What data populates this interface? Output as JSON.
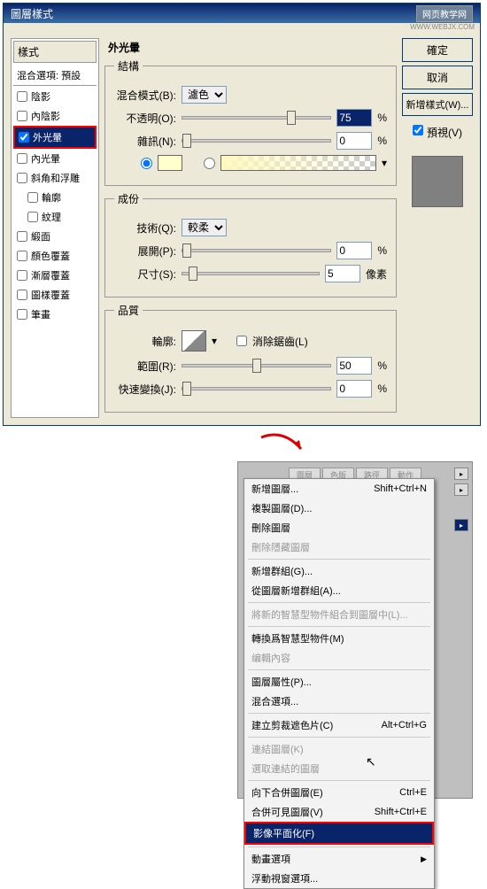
{
  "dialog": {
    "title": "圖層樣式",
    "badge": "网页教学网",
    "badge_sub": "WWW.WEBJX.COM"
  },
  "side": {
    "header": "樣式",
    "blend_line": "混合選項: 預設",
    "items": [
      {
        "label": "陰影",
        "checked": false,
        "selected": false
      },
      {
        "label": "內陰影",
        "checked": false,
        "selected": false
      },
      {
        "label": "外光暈",
        "checked": true,
        "selected": true
      },
      {
        "label": "內光暈",
        "checked": false,
        "selected": false
      },
      {
        "label": "斜角和浮雕",
        "checked": false,
        "selected": false
      },
      {
        "label": "輪廓",
        "checked": false,
        "selected": false,
        "indent": true
      },
      {
        "label": "紋理",
        "checked": false,
        "selected": false,
        "indent": true
      },
      {
        "label": "緞面",
        "checked": false,
        "selected": false
      },
      {
        "label": "顏色覆蓋",
        "checked": false,
        "selected": false
      },
      {
        "label": "漸層覆蓋",
        "checked": false,
        "selected": false
      },
      {
        "label": "圖樣覆蓋",
        "checked": false,
        "selected": false
      },
      {
        "label": "筆畫",
        "checked": false,
        "selected": false
      }
    ]
  },
  "outer_glow": {
    "title": "外光暈",
    "structure": {
      "legend": "結構",
      "blend_mode_label": "混合模式(B):",
      "blend_mode_value": "濾色",
      "opacity_label": "不透明(O):",
      "opacity_value": "75",
      "opacity_unit": "%",
      "noise_label": "雜訊(N):",
      "noise_value": "0",
      "noise_unit": "%"
    },
    "elements": {
      "legend": "成份",
      "technique_label": "技術(Q):",
      "technique_value": "較柔",
      "spread_label": "展開(P):",
      "spread_value": "0",
      "spread_unit": "%",
      "size_label": "尺寸(S):",
      "size_value": "5",
      "size_unit": "像素"
    },
    "quality": {
      "legend": "品質",
      "contour_label": "輪廓:",
      "antialias_label": "消除鋸齒(L)",
      "range_label": "範圍(R):",
      "range_value": "50",
      "range_unit": "%",
      "jitter_label": "快速變換(J):",
      "jitter_value": "0",
      "jitter_unit": "%"
    }
  },
  "buttons": {
    "ok": "確定",
    "cancel": "取消",
    "new_style": "新增樣式(W)...",
    "preview": "預視(V)"
  },
  "menu": {
    "tabs": [
      "圖層",
      "色版",
      "路徑",
      "動作"
    ],
    "items": [
      {
        "label": "新增圖層...",
        "shortcut": "Shift+Ctrl+N"
      },
      {
        "label": "複製圖層(D)..."
      },
      {
        "label": "刪除圖層"
      },
      {
        "label": "刪除隱藏圖層",
        "disabled": true
      },
      {
        "sep": true
      },
      {
        "label": "新增群組(G)..."
      },
      {
        "label": "從圖層新增群組(A)..."
      },
      {
        "sep": true
      },
      {
        "label": "將新的智慧型物件組合到圖層中(L)...",
        "disabled": true
      },
      {
        "sep": true
      },
      {
        "label": "轉換爲智慧型物件(M)"
      },
      {
        "label": "编輯內容",
        "disabled": true
      },
      {
        "sep": true
      },
      {
        "label": "圖層屬性(P)..."
      },
      {
        "label": "混合選項..."
      },
      {
        "sep": true
      },
      {
        "label": "建立剪裁遮色片(C)",
        "shortcut": "Alt+Ctrl+G"
      },
      {
        "sep": true
      },
      {
        "label": "連結圖層(K)",
        "disabled": true
      },
      {
        "label": "選取連結的圖層",
        "disabled": true
      },
      {
        "sep": true
      },
      {
        "label": "向下合併圖層(E)",
        "shortcut": "Ctrl+E"
      },
      {
        "label": "合併可見圖層(V)",
        "shortcut": "Shift+Ctrl+E"
      },
      {
        "label": "影像平面化(F)",
        "selected": true
      },
      {
        "sep": true
      },
      {
        "label": "動畫選項",
        "submenu": true
      },
      {
        "label": "浮動視窗選項..."
      }
    ]
  }
}
